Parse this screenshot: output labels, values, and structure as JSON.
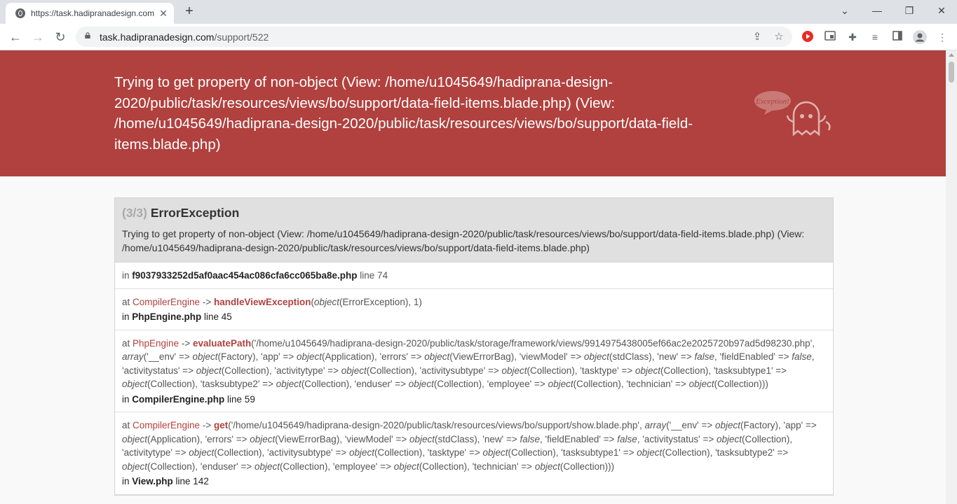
{
  "browser": {
    "tab_title": "https://task.hadipranadesign.com",
    "url_host": "task.hadipranadesign.com",
    "url_path": "/support/522"
  },
  "error": {
    "header": "Trying to get property of non-object (View: /home/u1045649/hadiprana-design-2020/public/task/resources/views/bo/support/data-field-items.blade.php) (View: /home/u1045649/hadiprana-design-2020/public/task/resources/views/bo/support/data-field-items.blade.php)",
    "ghost_label": "Exception!",
    "count": "(3/3)",
    "type": "ErrorException",
    "message": "Trying to get property of non-object (View: /home/u1045649/hadiprana-design-2020/public/task/resources/views/bo/support/data-field-items.blade.php) (View: /home/u1045649/hadiprana-design-2020/public/task/resources/views/bo/support/data-field-items.blade.php)"
  },
  "trace": [
    {
      "in_file": "f9037933252d5af0aac454ac086cfa6cc065ba8e.php",
      "line": "line 74"
    },
    {
      "cls": "CompilerEngine",
      "fn": "handleViewException",
      "args_pre": "(",
      "arg_kw": "object",
      "args_post": "(ErrorException), 1)",
      "in_file": "PhpEngine.php",
      "line": "line 45"
    },
    {
      "cls": "PhpEngine",
      "fn": "evaluatePath",
      "in_file": "CompilerEngine.php",
      "line": "line 59"
    },
    {
      "cls": "CompilerEngine",
      "fn": "get",
      "in_file": "View.php",
      "line": "line 142"
    }
  ]
}
